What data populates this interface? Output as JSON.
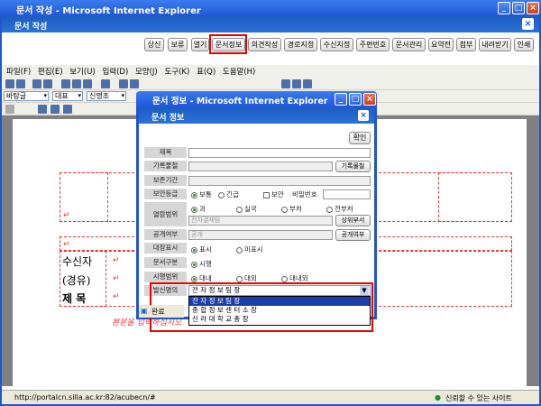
{
  "outer_window": {
    "title": "문서 작성 - Microsoft Internet Explorer"
  },
  "doc_header": {
    "title": "문서 작성"
  },
  "top_buttons": [
    "상신",
    "보류",
    "열기",
    "문서정보",
    "의견작성",
    "경로지정",
    "수신지정",
    "주편번호",
    "문서관리",
    "요약전",
    "첨부",
    "내려받기",
    "인쇄"
  ],
  "menubar": [
    "파일(F)",
    "편집(E)",
    "보기(U)",
    "입력(D)",
    "모양(J)",
    "도구(K)",
    "표(Q)",
    "도움말(H)"
  ],
  "toolbar3": {
    "font_style": "바탕글",
    "font_type": "대표",
    "font_name": "신명조"
  },
  "document": {
    "receiver_label": "수신자",
    "via_label": "(경유)",
    "subject_label": "제  목",
    "mark": "↵",
    "body_hint": "본문을 입력하십시오"
  },
  "inner_window": {
    "title": "문서 정보 - Microsoft Internet Explorer",
    "header": "문서 정보",
    "confirm": "확인",
    "rows": {
      "title": "제목",
      "record": "기록물철",
      "record_btn": "기록물철",
      "retention": "보존기간",
      "security": "보안등급",
      "security_opts": [
        "보통",
        "긴급",
        "보안",
        "비밀번호"
      ],
      "range": "열람범위",
      "range_opts": [
        "과",
        "실국",
        "부처",
        "전부처"
      ],
      "range_field": "전자결재팀",
      "range_btn": "상위부서",
      "public": "공개여부",
      "public_field": "공개",
      "public_btn": "공개여부",
      "display": "대장표시",
      "display_opts": [
        "표시",
        "미표시"
      ],
      "doc_type": "문서구분",
      "doc_type_opt": "시행",
      "exec": "시행범위",
      "exec_opts": [
        "대내",
        "대외",
        "대내외"
      ],
      "sender": "발신명의",
      "sender_value": "전 자 정 보 팀 장",
      "sender_options": [
        "전 자 정 보 팀 장",
        "종 합 정 보 센 터 소 장",
        "신 라 대 학 교 총 장"
      ]
    },
    "status": "완료"
  },
  "status_bar": {
    "url": "http://portalcn.silla.ac.kr:82/acubecn/#",
    "zone": "신뢰할 수 있는 사이트"
  }
}
